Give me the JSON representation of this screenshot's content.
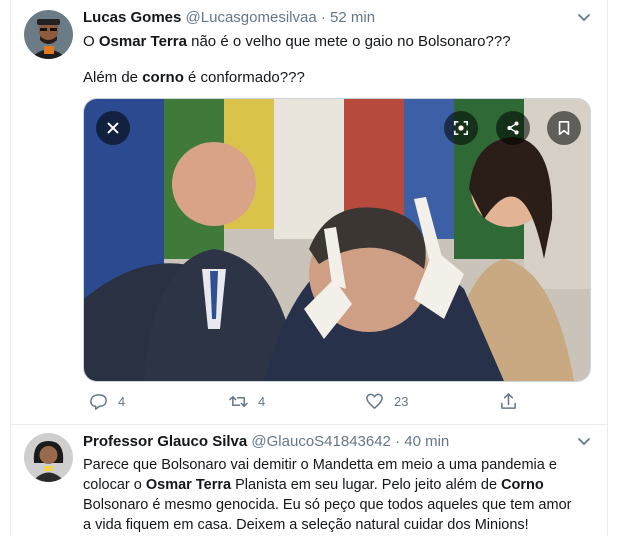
{
  "tweet1": {
    "name": "Lucas Gomes",
    "handle": "@Lucasgomesilvaa",
    "dot": "·",
    "time": "52 min",
    "line1_pre": "O ",
    "line1_bold": "Osmar Terra",
    "line1_post": " não é o velho que mete o gaio no Bolsonaro???",
    "line2_pre": "Além de ",
    "line2_bold": "corno",
    "line2_post": " é conformado???",
    "actions": {
      "reply": "4",
      "retweet": "4",
      "like": "23"
    }
  },
  "tweet2": {
    "name": "Professor Glauco Silva",
    "handle": "@GlaucoS41843642",
    "dot": "·",
    "time": "40 min",
    "l1": "Parece que Bolsonaro vai demitir o Mandetta em meio a uma pandemia e",
    "l2_pre": "colocar o ",
    "l2_bold": "Osmar Terra",
    "l2_mid": " Planista em seu lugar. Pelo jeito além de ",
    "l2_bold2": "Corno",
    "l3": " Bolsonaro é mesmo genocida. Eu só peço que todos aqueles que tem amor",
    "l4": "a vida fiquem em casa. Deixem a seleção natural cuidar dos Minions!"
  },
  "icons": {
    "caret": "chevron-down-icon",
    "close": "close-icon",
    "lens": "lens-icon",
    "share": "share-icon",
    "bookmark": "bookmark-icon",
    "reply": "reply-icon",
    "retweet": "retweet-icon",
    "like": "heart-icon",
    "share_action": "share-upload-icon"
  },
  "colors": {
    "text": "#14171a",
    "muted": "#657786",
    "divider": "#e6ecf0"
  }
}
